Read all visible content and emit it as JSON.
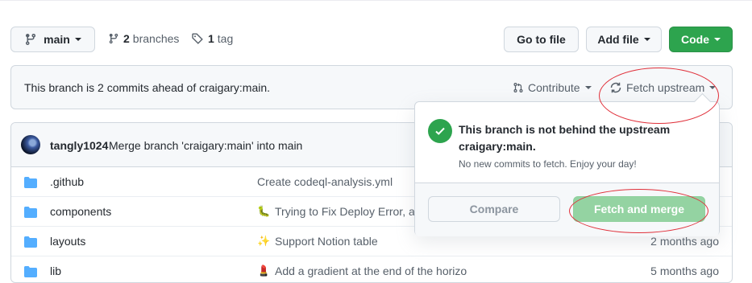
{
  "toolbar": {
    "branch_label": "main",
    "branches_count": "2",
    "branches_text": "branches",
    "tags_count": "1",
    "tags_text": "tag",
    "goto_file_label": "Go to file",
    "add_file_label": "Add file",
    "code_label": "Code"
  },
  "banner": {
    "message": "This branch is 2 commits ahead of craigary:main.",
    "contribute_label": "Contribute",
    "fetch_upstream_label": "Fetch upstream"
  },
  "latest_commit": {
    "author": "tangly1024",
    "message": "Merge branch 'craigary:main' into main"
  },
  "files": [
    {
      "name": ".github",
      "message": "Create codeql-analysis.yml",
      "emoji": "",
      "age": ""
    },
    {
      "name": "components",
      "message": "Trying to Fix Deploy Error, ag",
      "emoji": "🐛",
      "age": ""
    },
    {
      "name": "layouts",
      "message": "Support Notion table",
      "emoji": "✨",
      "age": "2 months ago"
    },
    {
      "name": "lib",
      "message": "Add a gradient at the end of the horizo",
      "emoji": "💄",
      "age": "5 months ago"
    }
  ],
  "popover": {
    "title": "This branch is not behind the upstream craigary:main.",
    "subtitle": "No new commits to fetch. Enjoy your day!",
    "compare_label": "Compare",
    "fetch_merge_label": "Fetch and merge"
  },
  "icons": {
    "branch": "git-branch-icon",
    "tag": "tag-icon",
    "contribute": "git-pull-request-icon",
    "sync": "sync-icon",
    "check": "check-circle-icon",
    "folder": "folder-icon"
  },
  "colors": {
    "primary_green": "#2da44e",
    "disabled_green": "#94d3a2",
    "folder_blue": "#54aeff",
    "annotation_red": "#e0303a"
  }
}
